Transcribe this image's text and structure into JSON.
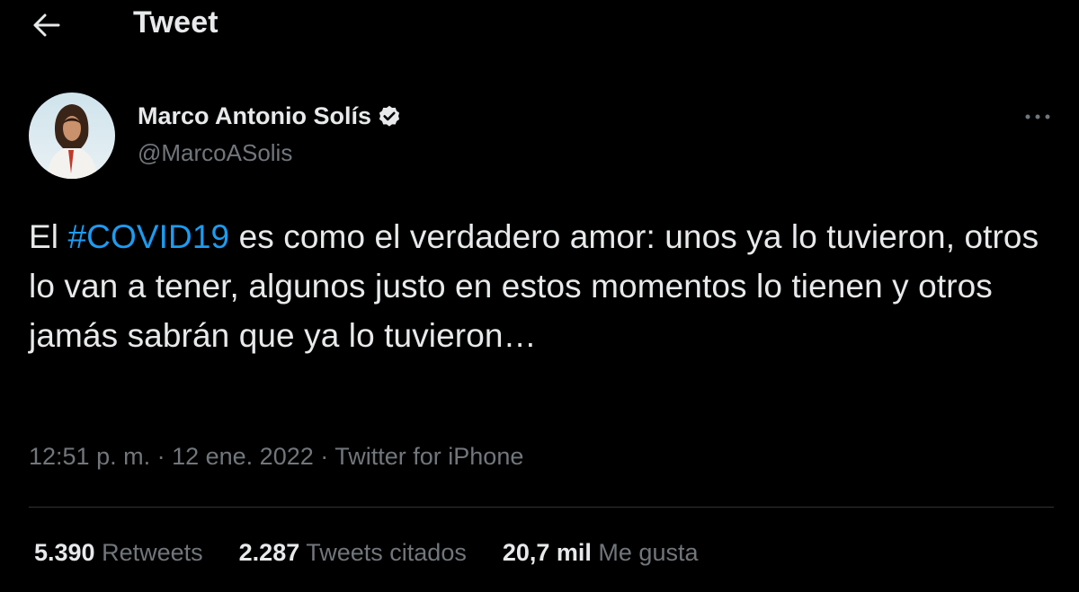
{
  "header": {
    "title": "Tweet",
    "back_icon": "arrow-left-icon"
  },
  "author": {
    "display_name": "Marco Antonio Solís",
    "handle": "@MarcoASolis",
    "verified_icon": "verified-badge-icon",
    "avatar": "profile-photo"
  },
  "more_icon": "more-horizontal-icon",
  "tweet": {
    "text_before": "El ",
    "hashtag": "#COVID19",
    "text_after": " es como el verdadero amor: unos ya lo tuvieron, otros lo van a tener, algunos justo en estos momentos lo tienen y otros jamás sabrán que ya lo tuvieron…"
  },
  "meta": {
    "time": "12:51 p. m.",
    "separator": " · ",
    "date": "12 ene. 2022",
    "source": "Twitter for iPhone"
  },
  "stats": {
    "retweets_count": "5.390",
    "retweets_label": "Retweets",
    "quotes_count": "2.287",
    "quotes_label": "Tweets citados",
    "likes_count": "20,7 mil",
    "likes_label": "Me gusta"
  },
  "colors": {
    "background": "#000000",
    "text": "#e7e9ea",
    "secondary": "#71767b",
    "accent": "#1d9bf0",
    "divider": "#2f3336"
  }
}
